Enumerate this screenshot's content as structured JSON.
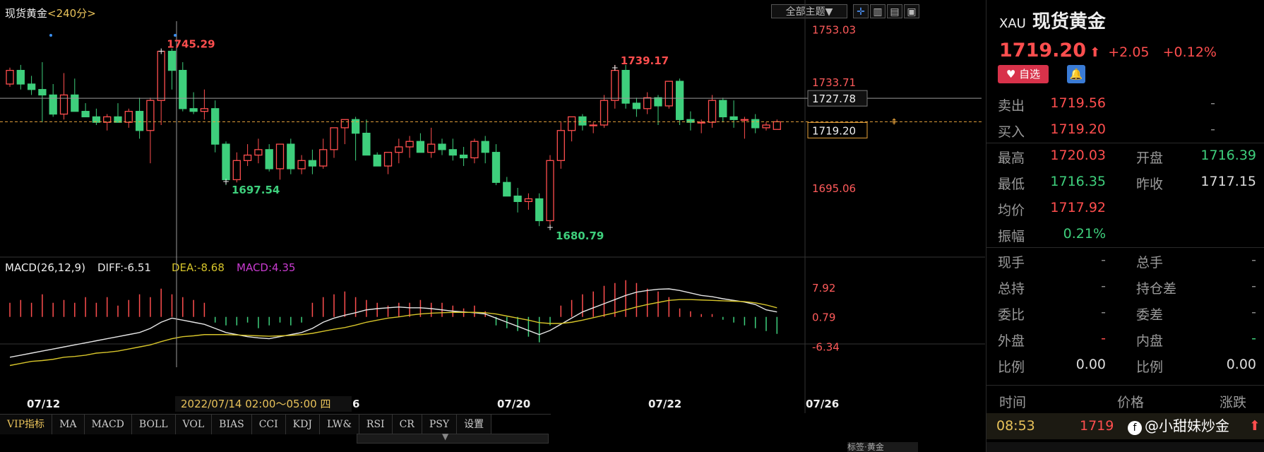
{
  "chart": {
    "title": "现货黄金",
    "period": "<240分>",
    "toolbar": {
      "theme_button": "全部主题▼"
    },
    "price_axis": [
      {
        "label": "1753.03",
        "value": 1753.03
      },
      {
        "label": "1733.71",
        "value": 1733.71
      },
      {
        "label": "1695.06",
        "value": 1695.06
      }
    ],
    "crosshair_price": "1727.78",
    "current_price_tag": "1719.20",
    "annotations": [
      {
        "label": "1745.29",
        "value": 1745.29,
        "color": "#ff4e4e"
      },
      {
        "label": "1697.54",
        "value": 1697.54,
        "color": "#3ecf7c"
      },
      {
        "label": "1739.17",
        "value": 1739.17,
        "color": "#ff4e4e"
      },
      {
        "label": "1680.79",
        "value": 1680.79,
        "color": "#3ecf7c"
      }
    ],
    "macd": {
      "name": "MACD(26,12,9)",
      "diff": "DIFF:-6.51",
      "dea": "DEA:-8.68",
      "macd": "MACD:4.35"
    },
    "macd_axis": [
      {
        "label": "7.92",
        "value": 7.92
      },
      {
        "label": "0.79",
        "value": 0.79
      },
      {
        "label": "-6.34",
        "value": -6.34
      }
    ],
    "x_axis": [
      "07/12",
      "6",
      "07/20",
      "07/22",
      "07/26"
    ],
    "crosshair_time": "2022/07/14 02:00～05:00 四",
    "indicator_tabs": [
      "VIP指标",
      "MA",
      "MACD",
      "BOLL",
      "VOL",
      "BIAS",
      "CCI",
      "KDJ",
      "LW&",
      "RSI",
      "CR",
      "PSY",
      "设置"
    ],
    "colors": {
      "up": "#ff4e4e",
      "down": "#3ecf7c",
      "diff": "#e6e6e6",
      "dea": "#d6c42a",
      "macd_label": "#c93bd0",
      "current_line": "#e8a33c"
    }
  },
  "chart_data": {
    "type": "candlestick",
    "ylim": [
      1672,
      1756
    ],
    "candles": [
      [
        1733,
        1739,
        1732,
        1738
      ],
      [
        1738,
        1740,
        1731,
        1733
      ],
      [
        1733,
        1736,
        1729,
        1731
      ],
      [
        1731,
        1741,
        1719,
        1729
      ],
      [
        1729,
        1733,
        1721,
        1722
      ],
      [
        1722,
        1737,
        1720,
        1729
      ],
      [
        1729,
        1735,
        1726,
        1723
      ],
      [
        1723,
        1726,
        1721,
        1721
      ],
      [
        1721,
        1724,
        1718,
        1719
      ],
      [
        1719,
        1722,
        1716,
        1721
      ],
      [
        1721,
        1726,
        1719,
        1719
      ],
      [
        1719,
        1724,
        1717,
        1723
      ],
      [
        1723,
        1728,
        1713,
        1716
      ],
      [
        1716,
        1728,
        1704,
        1727
      ],
      [
        1727,
        1744,
        1718,
        1745
      ],
      [
        1745,
        1746,
        1731,
        1738
      ],
      [
        1738,
        1741,
        1723,
        1724
      ],
      [
        1724,
        1730,
        1722,
        1723
      ],
      [
        1723,
        1731,
        1720,
        1724
      ],
      [
        1724,
        1727,
        1708,
        1711
      ],
      [
        1711,
        1712,
        1696,
        1698
      ],
      [
        1698,
        1708,
        1697,
        1705
      ],
      [
        1705,
        1711,
        1703,
        1707
      ],
      [
        1707,
        1713,
        1704,
        1709
      ],
      [
        1709,
        1711,
        1701,
        1702
      ],
      [
        1702,
        1709,
        1698,
        1711
      ],
      [
        1711,
        1713,
        1700,
        1702
      ],
      [
        1702,
        1707,
        1700,
        1705
      ],
      [
        1705,
        1709,
        1700,
        1703
      ],
      [
        1703,
        1713,
        1702,
        1709
      ],
      [
        1709,
        1716,
        1706,
        1717
      ],
      [
        1717,
        1720,
        1711,
        1720
      ],
      [
        1720,
        1721,
        1705,
        1715
      ],
      [
        1715,
        1720,
        1708,
        1707
      ],
      [
        1707,
        1708,
        1703,
        1703
      ],
      [
        1703,
        1708,
        1700,
        1708
      ],
      [
        1708,
        1713,
        1704,
        1710
      ],
      [
        1710,
        1714,
        1706,
        1712
      ],
      [
        1712,
        1715,
        1708,
        1708
      ],
      [
        1708,
        1717,
        1706,
        1711
      ],
      [
        1711,
        1713,
        1707,
        1709
      ],
      [
        1709,
        1713,
        1705,
        1707
      ],
      [
        1707,
        1710,
        1703,
        1706
      ],
      [
        1706,
        1713,
        1704,
        1712
      ],
      [
        1712,
        1714,
        1704,
        1708
      ],
      [
        1708,
        1711,
        1696,
        1697
      ],
      [
        1697,
        1699,
        1693,
        1692
      ],
      [
        1692,
        1695,
        1686,
        1690
      ],
      [
        1690,
        1693,
        1687,
        1691
      ],
      [
        1691,
        1693,
        1681,
        1683
      ],
      [
        1683,
        1707,
        1681,
        1705
      ],
      [
        1705,
        1719,
        1702,
        1716
      ],
      [
        1716,
        1721,
        1712,
        1721
      ],
      [
        1721,
        1722,
        1716,
        1718
      ],
      [
        1718,
        1719,
        1715,
        1718
      ],
      [
        1718,
        1729,
        1717,
        1727
      ],
      [
        1727,
        1740,
        1724,
        1738
      ],
      [
        1738,
        1740,
        1724,
        1726
      ],
      [
        1726,
        1728,
        1721,
        1724
      ],
      [
        1724,
        1730,
        1722,
        1728
      ],
      [
        1728,
        1729,
        1718,
        1725
      ],
      [
        1725,
        1732,
        1724,
        1734
      ],
      [
        1734,
        1735,
        1718,
        1720
      ],
      [
        1720,
        1723,
        1716,
        1719
      ],
      [
        1719,
        1720,
        1715,
        1719
      ],
      [
        1719,
        1729,
        1717,
        1727
      ],
      [
        1727,
        1728,
        1719,
        1721
      ],
      [
        1721,
        1727,
        1717,
        1720
      ],
      [
        1720,
        1721,
        1713,
        1720
      ],
      [
        1720,
        1722,
        1715,
        1717
      ],
      [
        1717,
        1719,
        1716,
        1718
      ],
      [
        1716.39,
        1720.03,
        1716.35,
        1719.2
      ]
    ],
    "macd_hist": [
      2.5,
      3,
      2.5,
      4,
      2.5,
      3,
      2.5,
      3.5,
      2.5,
      3.5,
      2,
      3,
      4,
      3.5,
      5,
      4,
      3.5,
      3,
      2.5,
      -1,
      -1.5,
      -1.5,
      -1,
      -2,
      -1.5,
      -1,
      -1.5,
      -1,
      2.5,
      3.5,
      4,
      4.5,
      3.5,
      3,
      2.5,
      2,
      2.5,
      2.5,
      3,
      2.5,
      2.5,
      2,
      1.5,
      2,
      1,
      -1.5,
      -2,
      -2.5,
      -3.5,
      -4.5,
      -1.5,
      2,
      3,
      4,
      4.5,
      5.5,
      6,
      6.5,
      6,
      5,
      4.5,
      3.5,
      1.5,
      1,
      0.5,
      0.5,
      -0.5,
      -1,
      -1.5,
      -2,
      -2.5,
      -3
    ],
    "macd_diff": [
      -9,
      -8.5,
      -8,
      -7.5,
      -7,
      -6.5,
      -6,
      -5.5,
      -5,
      -4.5,
      -4,
      -3.5,
      -3,
      -2,
      -0.5,
      0.5,
      0,
      -0.5,
      -1,
      -2,
      -3,
      -3.5,
      -4,
      -4.3,
      -4.5,
      -4,
      -3.5,
      -3,
      -2,
      -0.5,
      0.5,
      1.2,
      1.8,
      2.5,
      2.8,
      3,
      3.2,
      3,
      3,
      2.8,
      2.5,
      2.2,
      2,
      1.8,
      1.5,
      0.5,
      -0.5,
      -1.5,
      -2.5,
      -3.5,
      -2.5,
      -1,
      0.5,
      2,
      3,
      4,
      5,
      6,
      6.8,
      7.2,
      7.5,
      7.6,
      7.2,
      6.6,
      6,
      5.7,
      5.2,
      4.8,
      4.4,
      3.8,
      2.5,
      2
    ],
    "macd_dea": [
      -11,
      -10.5,
      -10,
      -9.8,
      -9.5,
      -9,
      -8.8,
      -8.5,
      -8,
      -7.8,
      -7.5,
      -7,
      -6.5,
      -6,
      -5.2,
      -4.5,
      -4,
      -3.8,
      -3.5,
      -3.5,
      -3.5,
      -3.6,
      -3.7,
      -3.8,
      -3.9,
      -3.8,
      -3.7,
      -3.5,
      -3.2,
      -2.7,
      -2.2,
      -1.8,
      -1.2,
      -0.5,
      0,
      0.5,
      0.8,
      1.2,
      1.5,
      1.7,
      1.8,
      1.9,
      1.9,
      1.9,
      1.8,
      1.5,
      1,
      0.5,
      0,
      -0.6,
      -0.8,
      -0.8,
      -0.5,
      0,
      0.6,
      1.2,
      1.8,
      2.5,
      3.2,
      3.8,
      4.3,
      4.8,
      5,
      5,
      4.9,
      4.8,
      4.7,
      4.6,
      4.5,
      4.2,
      3.7,
      3
    ]
  },
  "quote": {
    "symbol": "XAU",
    "name": "现货黄金",
    "price": "1719.20",
    "arrow": "⬆",
    "change": "+2.05",
    "change_pct": "+0.12%",
    "watch_label": "自选",
    "rows": [
      {
        "l1": "卖出",
        "v1": "1719.56",
        "c1": "red",
        "v1b": "-"
      },
      {
        "l1": "买入",
        "v1": "1719.20",
        "c1": "red",
        "v1b": "-"
      },
      {
        "l1": "最高",
        "v1": "1720.03",
        "c1": "red",
        "l2": "开盘",
        "v2": "1716.39",
        "c2": "green"
      },
      {
        "l1": "最低",
        "v1": "1716.35",
        "c1": "green",
        "l2": "昨收",
        "v2": "1717.15",
        "c2": "white"
      },
      {
        "l1": "均价",
        "v1": "1717.92",
        "c1": "red"
      },
      {
        "l1": "振幅",
        "v1": "0.21%",
        "c1": "green"
      },
      {
        "l1": "现手",
        "v1": "-",
        "c1": "dash",
        "l2": "总手",
        "v2": "-",
        "c2": "dash"
      },
      {
        "l1": "总持",
        "v1": "-",
        "c1": "dash",
        "l2": "持仓差",
        "v2": "-",
        "c2": "dash"
      },
      {
        "l1": "委比",
        "v1": "-",
        "c1": "dash",
        "l2": "委差",
        "v2": "-",
        "c2": "dash"
      },
      {
        "l1": "外盘",
        "v1": "-",
        "c1": "red",
        "l2": "内盘",
        "v2": "-",
        "c2": "green"
      },
      {
        "l1": "比例",
        "v1": "0.00",
        "c1": "white",
        "l2": "比例",
        "v2": "0.00",
        "c2": "white"
      }
    ],
    "ticks_header": {
      "time": "时间",
      "price": "价格",
      "change": "涨跌"
    },
    "tick_rows": [
      {
        "time": "08:53",
        "price": "1719",
        "change": "⬆"
      }
    ],
    "watermark": "@小甜妹炒金",
    "bottom_tab": "标签·黄金"
  }
}
